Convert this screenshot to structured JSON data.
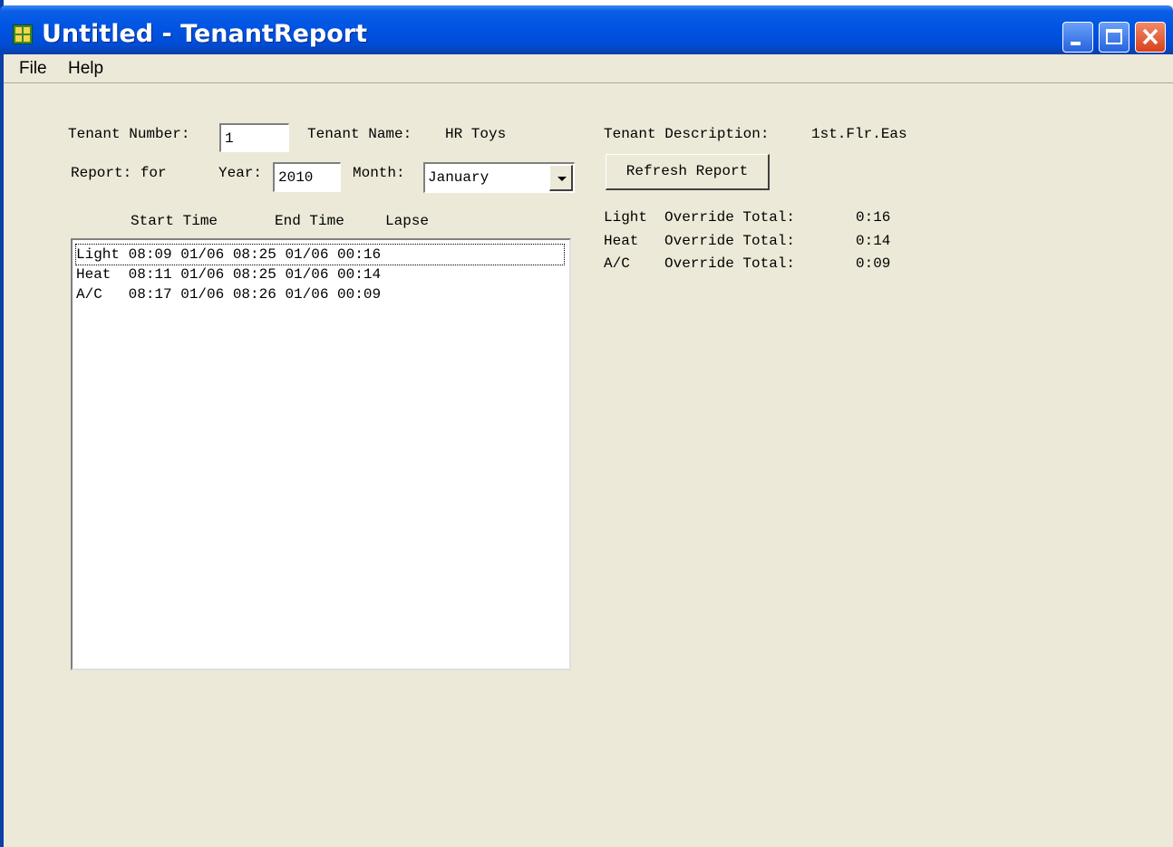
{
  "window": {
    "title": "Untitled - TenantReport"
  },
  "menu": {
    "items": [
      "File",
      "Help"
    ]
  },
  "form": {
    "tenant_number_label": "Tenant Number:",
    "tenant_number_value": "1",
    "tenant_name_label": "Tenant Name:",
    "tenant_name_value": "HR Toys",
    "tenant_description_label": "Tenant Description:",
    "tenant_description_value": "1st.Flr.Eas",
    "report_label": "Report: for",
    "year_label": "Year:",
    "year_value": "2010",
    "month_label": "Month:",
    "month_value": "January",
    "refresh_button": "Refresh Report"
  },
  "list": {
    "headers": [
      "Start Time",
      "End Time",
      "Lapse"
    ],
    "rows": [
      "Light 08:09 01/06 08:25 01/06 00:16",
      "Heat  08:11 01/06 08:25 01/06 00:14",
      "A/C   08:17 01/06 08:26 01/06 00:09"
    ]
  },
  "totals": [
    {
      "type": "Light",
      "label": "Override Total:",
      "value": "0:16"
    },
    {
      "type": "Heat",
      "label": "Override Total:",
      "value": "0:14"
    },
    {
      "type": "A/C",
      "label": "Override Total:",
      "value": "0:09"
    }
  ],
  "colors": {
    "titlebar": "#0054e3",
    "window_bg": "#ece9d8",
    "close_button": "#d8411c"
  }
}
